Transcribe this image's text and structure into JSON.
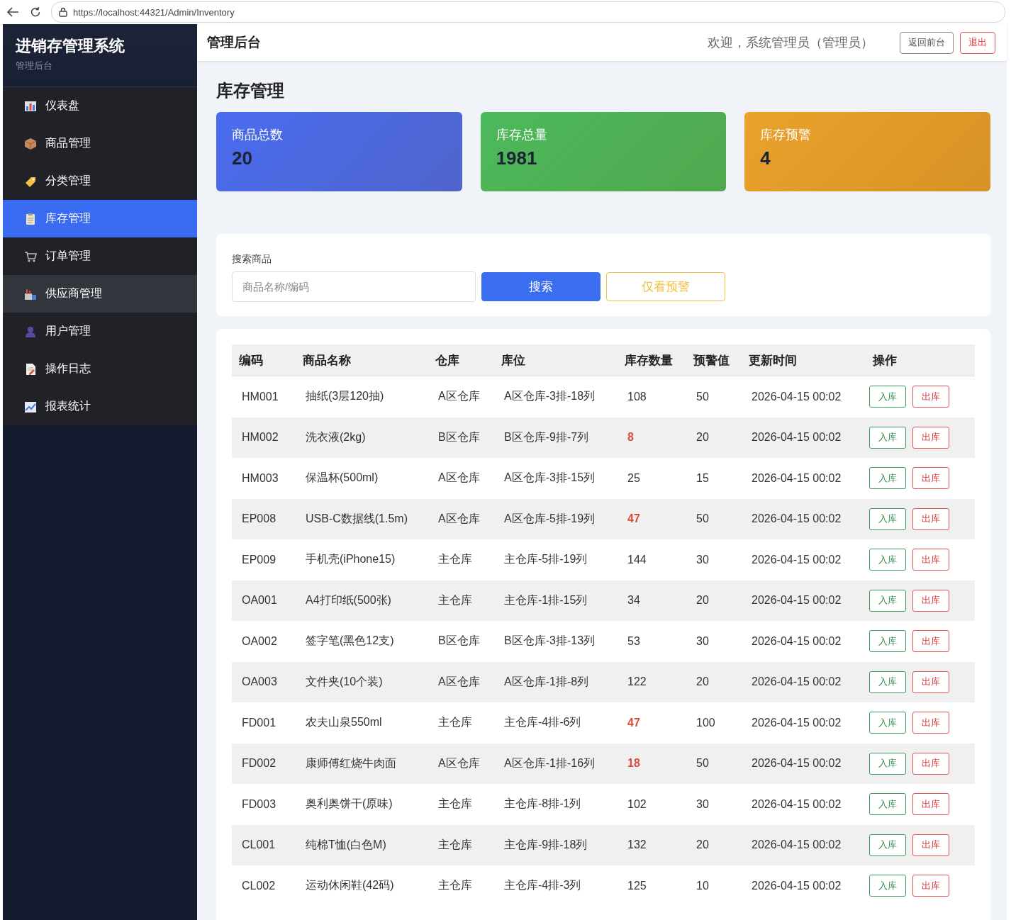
{
  "browser": {
    "url": "https://localhost:44321/Admin/Inventory"
  },
  "sidebar": {
    "title": "进销存管理系统",
    "subtitle": "管理后台",
    "items": [
      {
        "label": "仪表盘",
        "selected": false,
        "hovered": false
      },
      {
        "label": "商品管理",
        "selected": false,
        "hovered": false
      },
      {
        "label": "分类管理",
        "selected": false,
        "hovered": false
      },
      {
        "label": "库存管理",
        "selected": true,
        "hovered": false
      },
      {
        "label": "订单管理",
        "selected": false,
        "hovered": false
      },
      {
        "label": "供应商管理",
        "selected": false,
        "hovered": true
      },
      {
        "label": "用户管理",
        "selected": false,
        "hovered": false
      },
      {
        "label": "操作日志",
        "selected": false,
        "hovered": false
      },
      {
        "label": "报表统计",
        "selected": false,
        "hovered": false
      }
    ]
  },
  "topbar": {
    "title": "管理后台",
    "welcome": "欢迎，系统管理员（管理员）",
    "buttons": [
      {
        "label": "返回前台",
        "kind": "default"
      },
      {
        "label": "退出",
        "kind": "danger"
      }
    ]
  },
  "page_title": "库存管理",
  "stats": [
    {
      "label": "商品总数",
      "value": "20",
      "color": "#4a6cf0"
    },
    {
      "label": "库存总量",
      "value": "1981",
      "color": "#4cba5c"
    },
    {
      "label": "库存预警",
      "value": "4",
      "color": "#eaa22c"
    }
  ],
  "search": {
    "label": "搜索商品",
    "placeholder": "商品名称/编码",
    "buttons": [
      {
        "label": "搜索",
        "kind": "primary"
      },
      {
        "label": "仅看预警",
        "kind": "warning"
      }
    ]
  },
  "table": {
    "columns": [
      "编码",
      "商品名称",
      "仓库",
      "库位",
      "库存数量",
      "预警值",
      "更新时间",
      "操作"
    ],
    "rows": [
      {
        "code": "HM001",
        "name": "抽纸(3层120抽)",
        "warehouse": "A区仓库",
        "location": "A区仓库-3排-18列",
        "stock": "108",
        "low": false,
        "alert": "50",
        "updated": "2026-04-15 00:02",
        "actions": [
          {
            "label": "入库",
            "kind": "in"
          },
          {
            "label": "出库",
            "kind": "out"
          }
        ]
      },
      {
        "code": "HM002",
        "name": "洗衣液(2kg)",
        "warehouse": "B区仓库",
        "location": "B区仓库-9排-7列",
        "stock": "8",
        "low": true,
        "alert": "20",
        "updated": "2026-04-15 00:02",
        "actions": [
          {
            "label": "入库",
            "kind": "in"
          },
          {
            "label": "出库",
            "kind": "out"
          }
        ]
      },
      {
        "code": "HM003",
        "name": "保温杯(500ml)",
        "warehouse": "A区仓库",
        "location": "A区仓库-3排-15列",
        "stock": "25",
        "low": false,
        "alert": "15",
        "updated": "2026-04-15 00:02",
        "actions": [
          {
            "label": "入库",
            "kind": "in"
          },
          {
            "label": "出库",
            "kind": "out"
          }
        ]
      },
      {
        "code": "EP008",
        "name": "USB-C数据线(1.5m)",
        "warehouse": "A区仓库",
        "location": "A区仓库-5排-19列",
        "stock": "47",
        "low": true,
        "alert": "50",
        "updated": "2026-04-15 00:02",
        "actions": [
          {
            "label": "入库",
            "kind": "in"
          },
          {
            "label": "出库",
            "kind": "out"
          }
        ]
      },
      {
        "code": "EP009",
        "name": "手机壳(iPhone15)",
        "warehouse": "主仓库",
        "location": "主仓库-5排-19列",
        "stock": "144",
        "low": false,
        "alert": "30",
        "updated": "2026-04-15 00:02",
        "actions": [
          {
            "label": "入库",
            "kind": "in"
          },
          {
            "label": "出库",
            "kind": "out"
          }
        ]
      },
      {
        "code": "OA001",
        "name": "A4打印纸(500张)",
        "warehouse": "主仓库",
        "location": "主仓库-1排-15列",
        "stock": "34",
        "low": false,
        "alert": "20",
        "updated": "2026-04-15 00:02",
        "actions": [
          {
            "label": "入库",
            "kind": "in"
          },
          {
            "label": "出库",
            "kind": "out"
          }
        ]
      },
      {
        "code": "OA002",
        "name": "签字笔(黑色12支)",
        "warehouse": "B区仓库",
        "location": "B区仓库-3排-13列",
        "stock": "53",
        "low": false,
        "alert": "30",
        "updated": "2026-04-15 00:02",
        "actions": [
          {
            "label": "入库",
            "kind": "in"
          },
          {
            "label": "出库",
            "kind": "out"
          }
        ]
      },
      {
        "code": "OA003",
        "name": "文件夹(10个装)",
        "warehouse": "A区仓库",
        "location": "A区仓库-1排-8列",
        "stock": "122",
        "low": false,
        "alert": "20",
        "updated": "2026-04-15 00:02",
        "actions": [
          {
            "label": "入库",
            "kind": "in"
          },
          {
            "label": "出库",
            "kind": "out"
          }
        ]
      },
      {
        "code": "FD001",
        "name": "农夫山泉550ml",
        "warehouse": "主仓库",
        "location": "主仓库-4排-6列",
        "stock": "47",
        "low": true,
        "alert": "100",
        "updated": "2026-04-15 00:02",
        "actions": [
          {
            "label": "入库",
            "kind": "in"
          },
          {
            "label": "出库",
            "kind": "out"
          }
        ]
      },
      {
        "code": "FD002",
        "name": "康师傅红烧牛肉面",
        "warehouse": "A区仓库",
        "location": "A区仓库-1排-16列",
        "stock": "18",
        "low": true,
        "alert": "50",
        "updated": "2026-04-15 00:02",
        "actions": [
          {
            "label": "入库",
            "kind": "in"
          },
          {
            "label": "出库",
            "kind": "out"
          }
        ]
      },
      {
        "code": "FD003",
        "name": "奥利奥饼干(原味)",
        "warehouse": "主仓库",
        "location": "主仓库-8排-1列",
        "stock": "102",
        "low": false,
        "alert": "30",
        "updated": "2026-04-15 00:02",
        "actions": [
          {
            "label": "入库",
            "kind": "in"
          },
          {
            "label": "出库",
            "kind": "out"
          }
        ]
      },
      {
        "code": "CL001",
        "name": "纯棉T恤(白色M)",
        "warehouse": "主仓库",
        "location": "主仓库-9排-18列",
        "stock": "132",
        "low": false,
        "alert": "20",
        "updated": "2026-04-15 00:02",
        "actions": [
          {
            "label": "入库",
            "kind": "in"
          },
          {
            "label": "出库",
            "kind": "out"
          }
        ]
      },
      {
        "code": "CL002",
        "name": "运动休闲鞋(42码)",
        "warehouse": "主仓库",
        "location": "主仓库-4排-3列",
        "stock": "125",
        "low": false,
        "alert": "10",
        "updated": "2026-04-15 00:02",
        "actions": [
          {
            "label": "入库",
            "kind": "in"
          },
          {
            "label": "出库",
            "kind": "out"
          }
        ]
      }
    ]
  }
}
